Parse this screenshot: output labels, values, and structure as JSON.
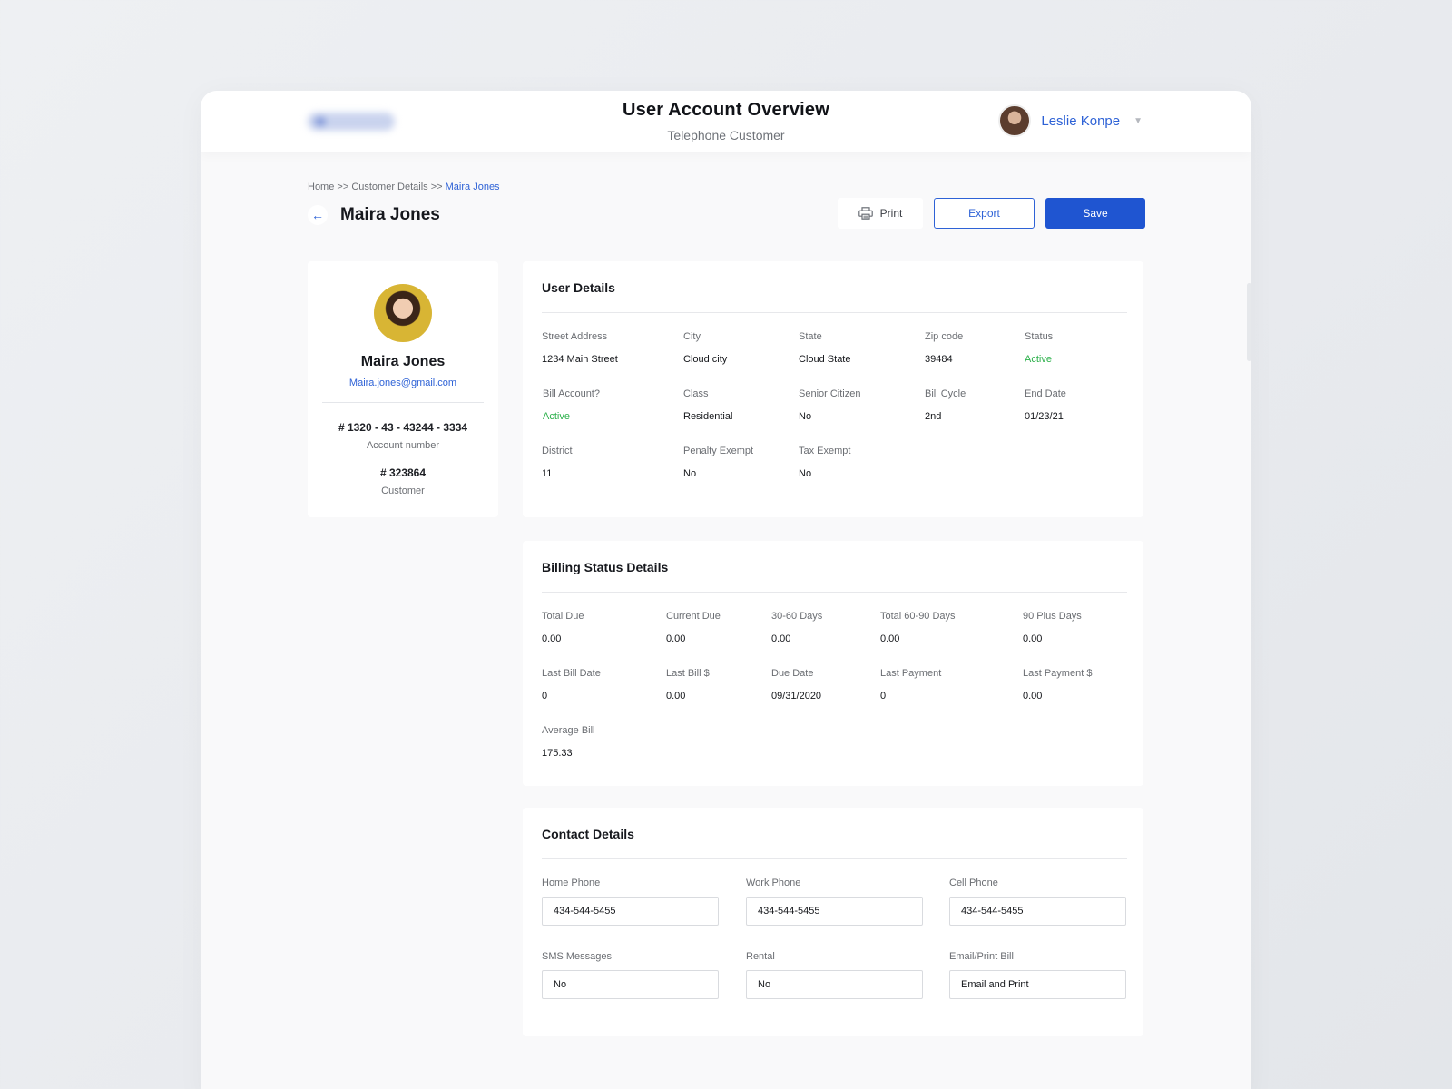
{
  "header": {
    "title": "User Account Overview",
    "subtitle": "Telephone Customer",
    "user_name": "Leslie Konpe"
  },
  "breadcrumb": {
    "home": "Home",
    "sep1": " >> ",
    "customer_details": "Customer Details",
    "sep2": " >> ",
    "current": "Maira Jones"
  },
  "page": {
    "title": "Maira Jones"
  },
  "actions": {
    "print": "Print",
    "export": "Export",
    "save": "Save"
  },
  "profile": {
    "name": "Maira Jones",
    "email": "Maira.jones@gmail.com",
    "account_number": "# 1320 - 43 - 43244 - 3334",
    "account_label": "Account number",
    "customer_number": "# 323864",
    "customer_label": "Customer"
  },
  "user_details": {
    "title": "User Details",
    "fields": [
      {
        "label": "Street Address",
        "value": "1234 Main Street"
      },
      {
        "label": "City",
        "value": "Cloud city"
      },
      {
        "label": "State",
        "value": "Cloud State"
      },
      {
        "label": "Zip code",
        "value": "39484"
      },
      {
        "label": "Status",
        "value": "Active"
      },
      {
        "label": "Bill Account?",
        "value": "Active"
      },
      {
        "label": "Class",
        "value": "Residential"
      },
      {
        "label": "Senior Citizen",
        "value": "No"
      },
      {
        "label": "Bill Cycle",
        "value": "2nd"
      },
      {
        "label": "End Date",
        "value": "01/23/21"
      },
      {
        "label": "District",
        "value": "11"
      },
      {
        "label": "Penalty Exempt",
        "value": "No"
      },
      {
        "label": "Tax Exempt",
        "value": "No"
      }
    ]
  },
  "billing": {
    "title": "Billing Status Details",
    "fields": [
      {
        "label": "Total Due",
        "value": "0.00"
      },
      {
        "label": "Current Due",
        "value": "0.00"
      },
      {
        "label": "30-60 Days",
        "value": "0.00"
      },
      {
        "label": "Total 60-90 Days",
        "value": "0.00"
      },
      {
        "label": "90 Plus Days",
        "value": "0.00"
      },
      {
        "label": "Last Bill Date",
        "value": "0"
      },
      {
        "label": "Last Bill $",
        "value": "0.00"
      },
      {
        "label": "Due Date",
        "value": "09/31/2020"
      },
      {
        "label": "Last Payment",
        "value": "0"
      },
      {
        "label": "Last Payment $",
        "value": "0.00"
      },
      {
        "label": "Average Bill",
        "value": "175.33"
      }
    ]
  },
  "contact": {
    "title": "Contact Details",
    "fields": [
      {
        "label": "Home Phone",
        "value": "434-544-5455"
      },
      {
        "label": "Work Phone",
        "value": "434-544-5455"
      },
      {
        "label": "Cell Phone",
        "value": "434-544-5455"
      },
      {
        "label": "SMS Messages",
        "value": "No"
      },
      {
        "label": "Rental",
        "value": "No"
      },
      {
        "label": "Email/Print Bill",
        "value": "Email and Print"
      }
    ]
  },
  "colors": {
    "accent": "#2e62d6",
    "primary_button": "#1f55d1",
    "status_active": "#2bb04a"
  },
  "icons": {
    "back": "arrow-left-icon",
    "print": "printer-icon",
    "caret": "chevron-down-icon"
  }
}
